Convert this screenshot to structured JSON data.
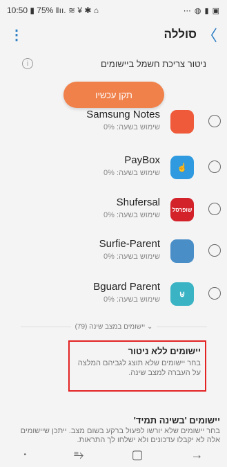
{
  "status": {
    "left": "10:50 ▮ 75% ‖ıı. ≋ ¥ ✱ ⌂",
    "right": "⋯ ◍ ▮ ▣"
  },
  "header": {
    "title": "סוללה",
    "menu_icon": "⋮",
    "back_icon": "〉"
  },
  "monitor": {
    "label": "ניטור צריכת חשמל ביישומים",
    "info_icon": "i"
  },
  "fix_button": "תקן עכשיו",
  "apps": [
    {
      "name": "Samsung Notes",
      "usage": "שימוש בשעה: 0%",
      "icon_color": "#ef5b3a",
      "icon_label": ""
    },
    {
      "name": "PayBox",
      "usage": "שימוש בשעה: 0%",
      "icon_color": "#2f9ae0",
      "icon_label": "☝"
    },
    {
      "name": "Shufersal",
      "usage": "שימוש בשעה: 0%",
      "icon_color": "#d3222a",
      "icon_label": "שופרסל"
    },
    {
      "name": "Surfie-Parent",
      "usage": "שימוש בשעה: 0%",
      "icon_color": "#4a8ec8",
      "icon_label": ""
    },
    {
      "name": "Bguard Parent",
      "usage": "שימוש בשעה: 0%",
      "icon_color": "#3ab4c4",
      "icon_label": "⊍"
    }
  ],
  "sleeping_divider": "יישומים במצב שינה (79)",
  "no_monitor": {
    "title": "יישומים ללא ניטור",
    "desc": "בחר יישומים שלא תוצג לגביהם המלצה על העברה למצב שינה."
  },
  "always_sleep": {
    "title": "יישומים 'בשינה תמיד'",
    "desc": "בחר יישומים שלא יורשו לפעול ברקע בשום מצב. ייתכן שיישומים אלה לא יקבלו עדכונים ולא ישלחו לך התראות."
  },
  "navbar": {
    "dot": "•",
    "recents": "⥱",
    "home": "▢",
    "back": "→"
  }
}
